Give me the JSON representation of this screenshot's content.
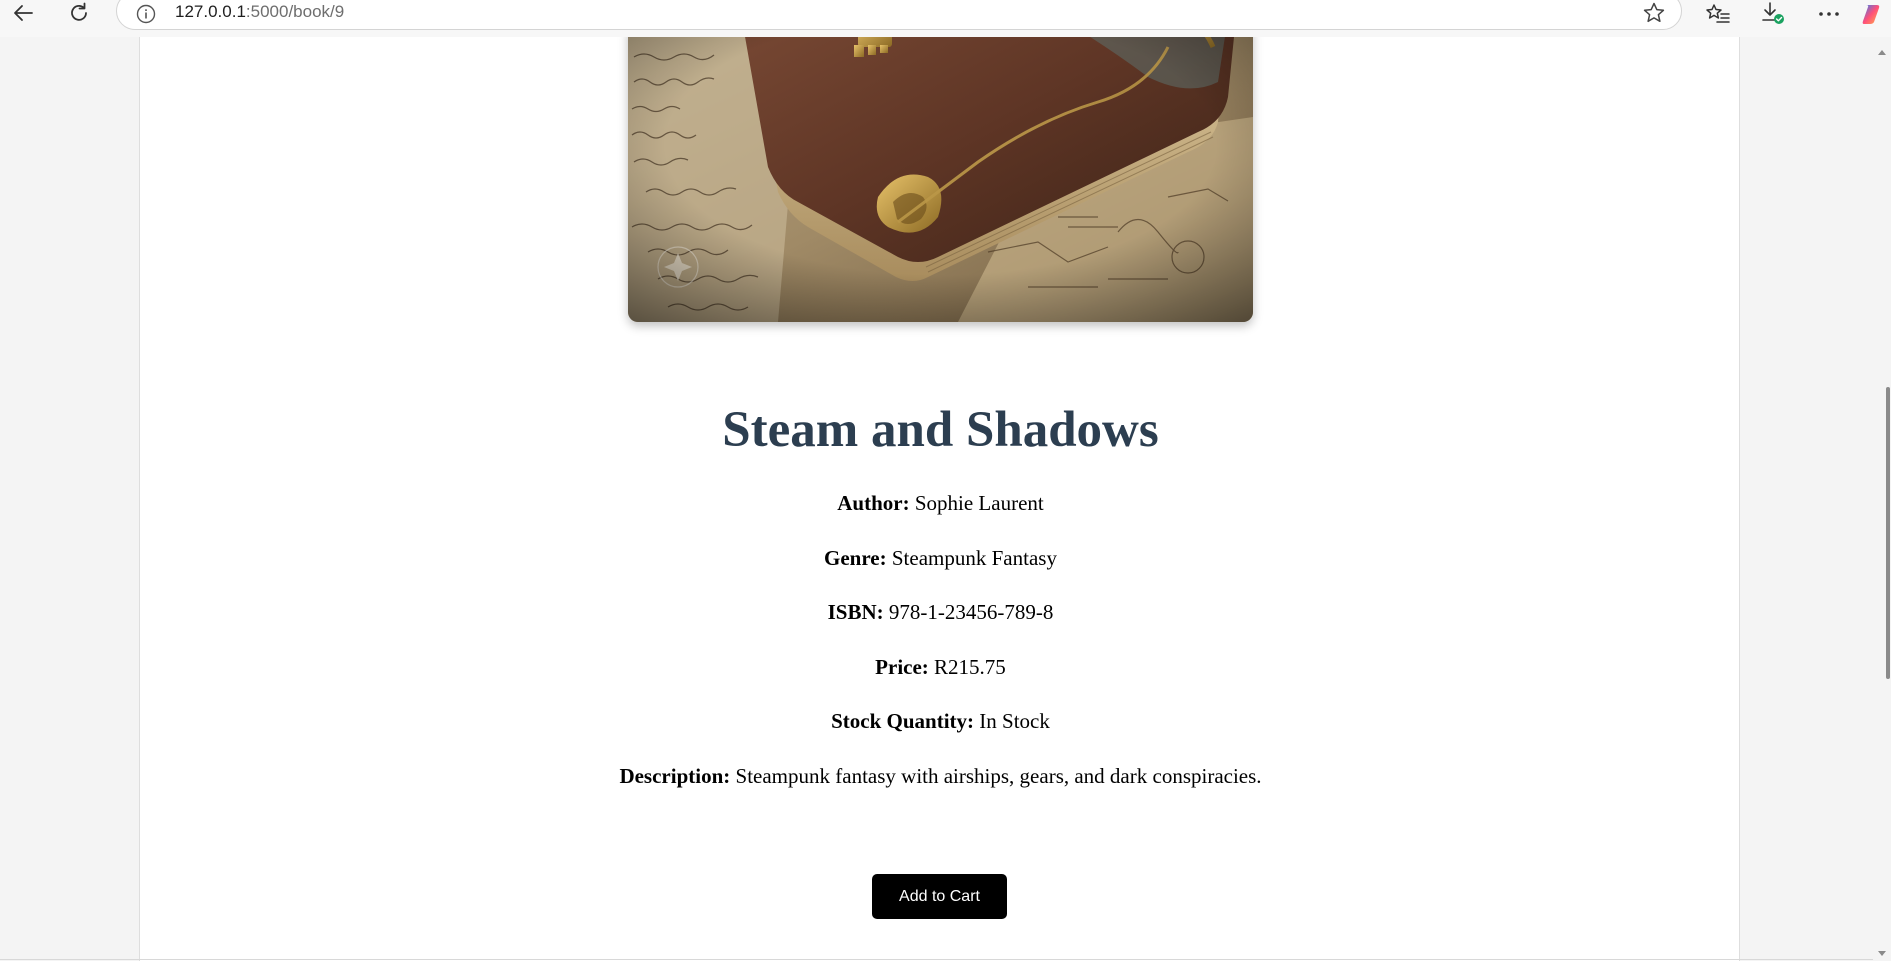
{
  "browser": {
    "url_host": "127.0.0.1",
    "url_path": ":5000/book/9",
    "icons": {
      "back": "back-arrow-icon",
      "reload": "reload-icon",
      "info": "info-icon",
      "favorite": "star-icon",
      "favorites": "favorites-icon",
      "downloads": "download-icon",
      "more": "more-icon",
      "copilot": "copilot-icon"
    }
  },
  "book": {
    "title": "Steam and Shadows",
    "author_label": "Author:",
    "author": "Sophie Laurent",
    "genre_label": "Genre:",
    "genre": "Steampunk Fantasy",
    "isbn_label": "ISBN:",
    "isbn": "978-1-23456-789-8",
    "price_label": "Price:",
    "price": "R215.75",
    "stock_label": "Stock Quantity:",
    "stock": "In Stock",
    "description_label": "Description:",
    "description": "Steampunk fantasy with airships, gears, and dark conspiracies.",
    "cover_icon": "book-cover-image"
  },
  "actions": {
    "add_to_cart": "Add to Cart"
  },
  "colors": {
    "title": "#2c3e50",
    "button_bg": "#000000",
    "button_text": "#ffffff"
  }
}
